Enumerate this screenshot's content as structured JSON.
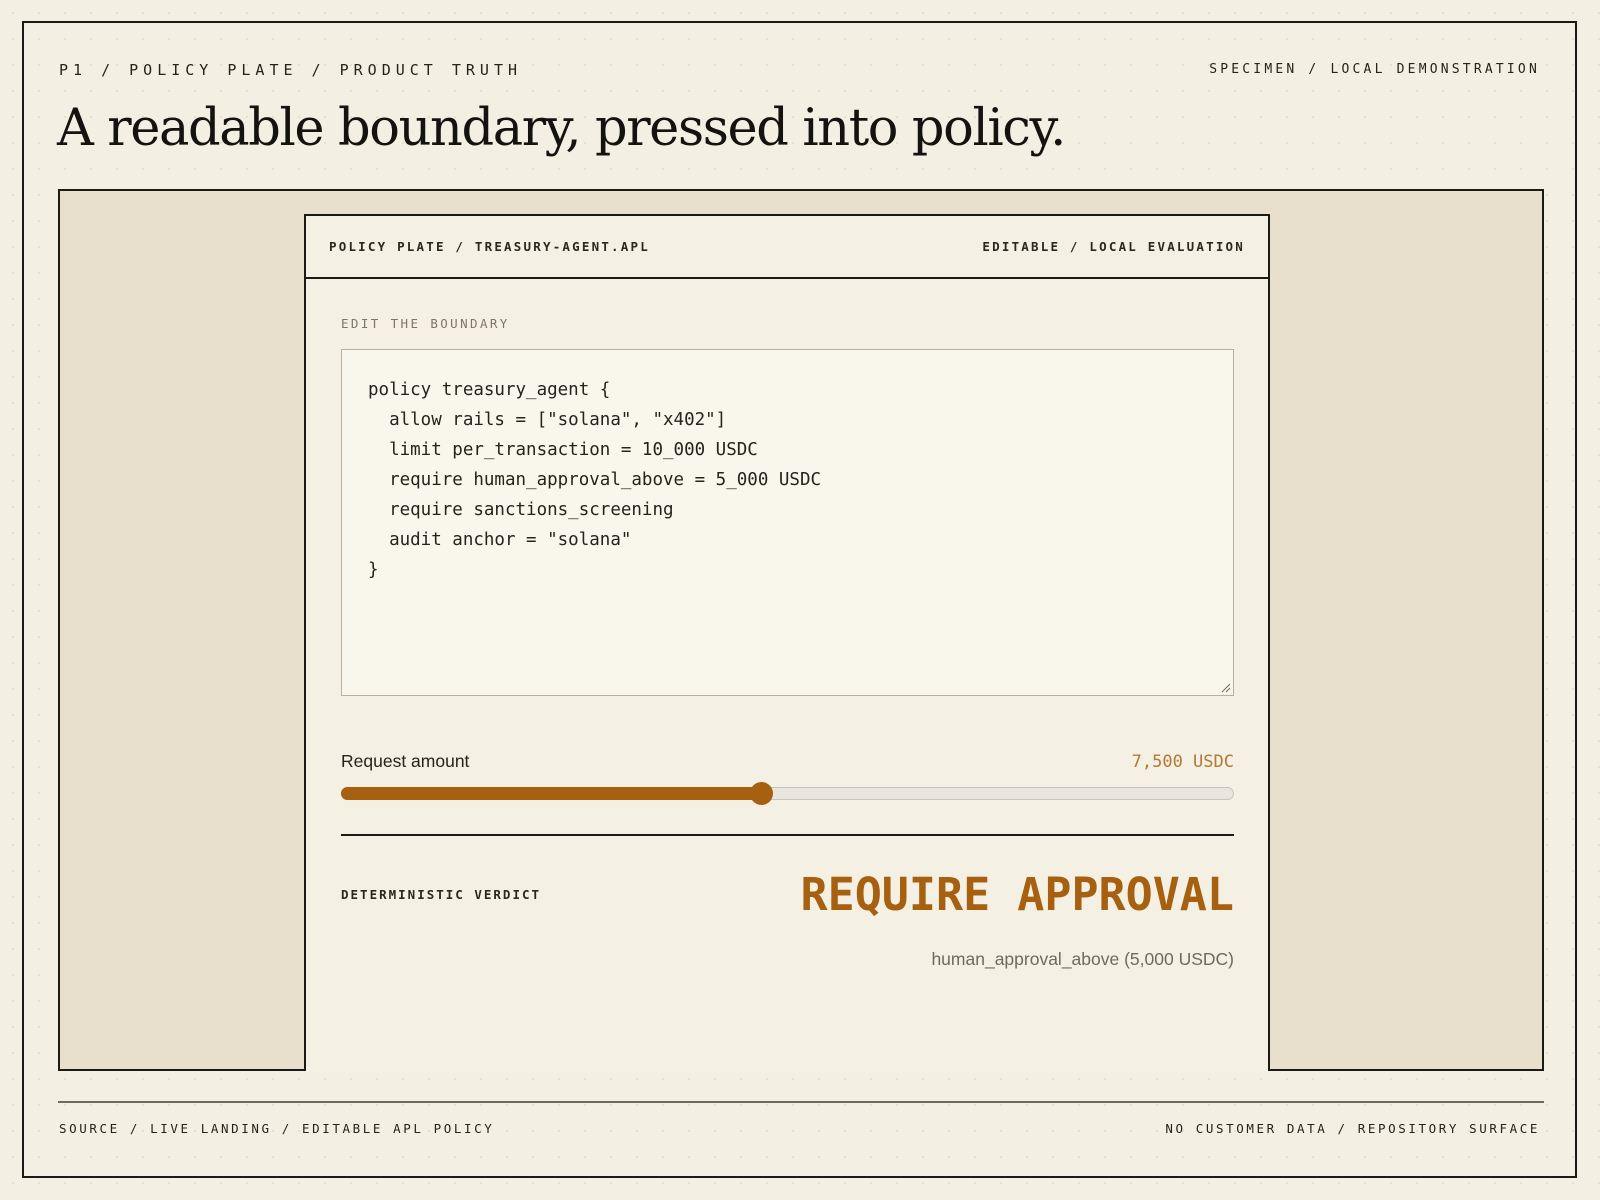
{
  "header": {
    "breadcrumb": "P1 / POLICY PLATE / PRODUCT TRUTH",
    "specimen_label": "SPECIMEN / LOCAL DEMONSTRATION",
    "title": "A readable boundary, pressed into policy."
  },
  "card": {
    "file_label": "POLICY PLATE / TREASURY-AGENT.APL",
    "mode_label": "EDITABLE / LOCAL EVALUATION",
    "editor_section_label": "EDIT THE BOUNDARY",
    "policy_source": "policy treasury_agent {\n  allow rails = [\"solana\", \"x402\"]\n  limit per_transaction = 10_000 USDC\n  require human_approval_above = 5_000 USDC\n  require sanctions_screening\n  audit anchor = \"solana\"\n}",
    "request_amount_label": "Request amount",
    "request_amount_value": "7,500 USDC",
    "slider_fraction": 0.47,
    "verdict_label": "DETERMINISTIC VERDICT",
    "verdict": "REQUIRE APPROVAL",
    "verdict_reason": "human_approval_above (5,000 USDC)"
  },
  "footer": {
    "source": "SOURCE / LIVE LANDING / EDITABLE APL POLICY",
    "note": "NO CUSTOMER DATA / REPOSITORY SURFACE"
  },
  "colors": {
    "accent": "#a6600f",
    "amount_text": "#b27a33",
    "ink": "#1c1a15",
    "paper": "#f3efe3",
    "stage": "#e8dfcc"
  }
}
